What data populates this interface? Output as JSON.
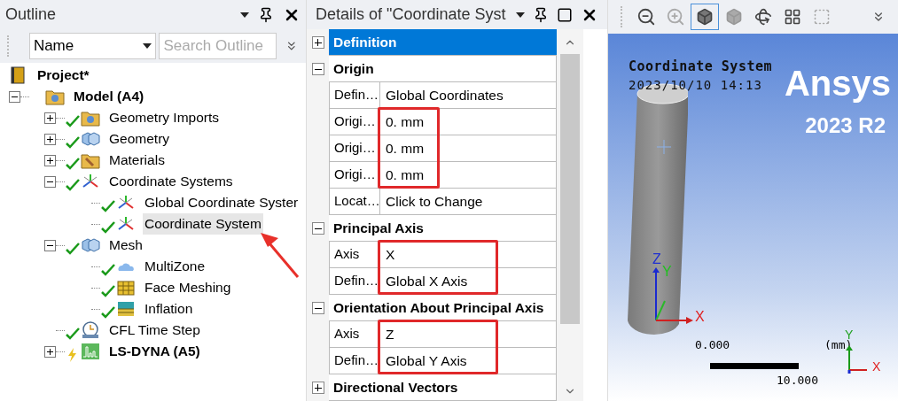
{
  "outline": {
    "title": "Outline",
    "filter": {
      "value": "Name"
    },
    "search": {
      "placeholder": "Search Outline"
    },
    "tree": [
      {
        "label": "Project*",
        "kind": "book",
        "bold": true,
        "selected": false,
        "children": [
          {
            "label": "Model (A4)",
            "kind": "model",
            "bold": true,
            "selected": false,
            "expanded": true,
            "children": [
              {
                "label": "Geometry Imports",
                "kind": "model",
                "bold": false,
                "selected": false,
                "expanded": false,
                "valid": true
              },
              {
                "label": "Geometry",
                "kind": "cubes",
                "bold": false,
                "selected": false,
                "expanded": false,
                "valid": true
              },
              {
                "label": "Materials",
                "kind": "materials",
                "bold": false,
                "selected": false,
                "expanded": false,
                "valid": true
              },
              {
                "label": "Coordinate Systems",
                "kind": "axes",
                "bold": false,
                "selected": false,
                "expanded": true,
                "valid": true,
                "children": [
                  {
                    "label": "Global Coordinate Syster",
                    "kind": "axes",
                    "bold": false,
                    "selected": false,
                    "valid": true
                  },
                  {
                    "label": "Coordinate System",
                    "kind": "axes",
                    "bold": false,
                    "selected": true,
                    "valid": true
                  }
                ]
              },
              {
                "label": "Mesh",
                "kind": "cubes",
                "bold": false,
                "selected": false,
                "expanded": true,
                "valid": true,
                "children": [
                  {
                    "label": "MultiZone",
                    "kind": "cloud",
                    "bold": false,
                    "selected": false,
                    "valid": true
                  },
                  {
                    "label": "Face Meshing",
                    "kind": "grid",
                    "bold": false,
                    "selected": false,
                    "valid": true
                  },
                  {
                    "label": "Inflation",
                    "kind": "layers",
                    "bold": false,
                    "selected": false,
                    "valid": true
                  }
                ]
              },
              {
                "label": "CFL Time Step",
                "kind": "clock",
                "bold": false,
                "selected": false,
                "valid": true
              },
              {
                "label": "LS-DYNA (A5)",
                "kind": "chart",
                "bold": true,
                "selected": false,
                "expanded": false,
                "valid": false
              }
            ]
          }
        ]
      }
    ]
  },
  "details": {
    "title": "Details of \"Coordinate Syst",
    "groups": [
      {
        "title": "Definition",
        "expanded": false,
        "selected": true
      },
      {
        "title": "Origin",
        "expanded": true,
        "selected": false,
        "rows": [
          {
            "label": "Defin…",
            "value": "Global Coordinates",
            "marked": false
          },
          {
            "label": "Origi…",
            "value": "0. mm",
            "marked": true
          },
          {
            "label": "Origi…",
            "value": "0. mm",
            "marked": true
          },
          {
            "label": "Origi…",
            "value": "0. mm",
            "marked": true
          },
          {
            "label": "Locat…",
            "value": "Click to Change",
            "marked": false
          }
        ]
      },
      {
        "title": "Principal Axis",
        "expanded": true,
        "selected": false,
        "rows": [
          {
            "label": "Axis",
            "value": "X",
            "marked": true
          },
          {
            "label": "Defin…",
            "value": "Global X Axis",
            "marked": true
          }
        ]
      },
      {
        "title": "Orientation About Principal Axis",
        "expanded": true,
        "selected": false,
        "rows": [
          {
            "label": "Axis",
            "value": "Z",
            "marked": true
          },
          {
            "label": "Defin…",
            "value": "Global Y Axis",
            "marked": true
          }
        ]
      },
      {
        "title": "Directional Vectors",
        "expanded": false,
        "selected": false
      }
    ]
  },
  "viewport": {
    "toolbar": [
      {
        "kind": "zoom-back",
        "selected": false,
        "disabled": false
      },
      {
        "kind": "zoom-forward",
        "selected": false,
        "disabled": true
      },
      {
        "kind": "cube-edges",
        "selected": true,
        "disabled": false
      },
      {
        "kind": "cube-solid",
        "selected": false,
        "disabled": false
      },
      {
        "kind": "rotate",
        "selected": false,
        "disabled": false
      },
      {
        "kind": "layout-add",
        "selected": false,
        "disabled": false
      },
      {
        "kind": "layout-remove",
        "selected": false,
        "disabled": true
      }
    ],
    "caption": "Coordinate System",
    "timestamp": "2023/10/10 14:13",
    "brand": "Ansys",
    "version": "2023 R2",
    "model_triad": {
      "z": "Z",
      "y": "Y",
      "x": "X"
    },
    "corner_triad": {
      "y": "Y",
      "x": "X"
    },
    "scale": {
      "start": "0.000",
      "end": "10.000",
      "unit": "(mm)"
    }
  }
}
